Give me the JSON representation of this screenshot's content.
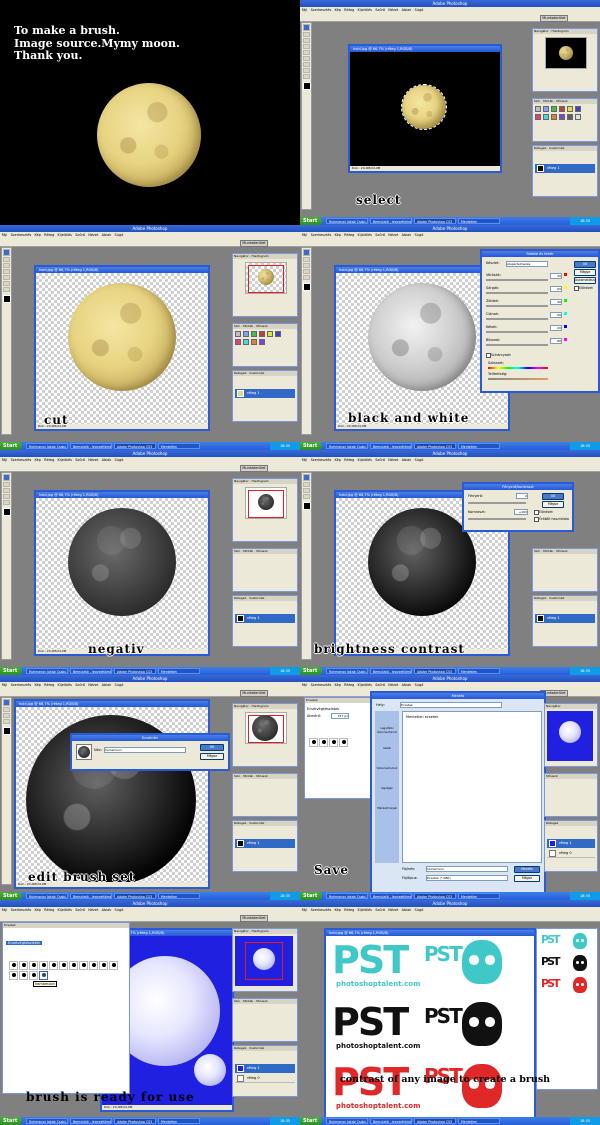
{
  "intro": {
    "line1": "To make a brush.",
    "line2": "Image source.Mymy moon.",
    "line3": "Thank you."
  },
  "app": {
    "title": "Adobe Photoshop",
    "menu": [
      "Fájl",
      "Szerkesztés",
      "Kép",
      "Réteg",
      "Kijelölés",
      "Szűrő",
      "Nézet",
      "Ablak",
      "Súgó"
    ],
    "workspace_button": "Munkaterület",
    "start_label": "Start",
    "tray_time": "18:35"
  },
  "document": {
    "title": "hold.jpg @ 66,7% (réteg 1,RGB/8)",
    "zoom": "66,67%",
    "status": "Dok.: 24,0M/24,0M"
  },
  "taskbar": {
    "items": [
      "Ruhmanov Jakab Csabi...",
      "Bemutató - Jegyzettömb",
      "Adobe Photoshop CS3",
      "Mentetlen"
    ]
  },
  "layers": {
    "row1": "réteg 1",
    "row2": "réteg 0"
  },
  "captions": {
    "select": "select",
    "cut": "cut",
    "bw": "black and white",
    "negativ": "negativ",
    "brightness": "brightness contrast",
    "edit": "edit brush set",
    "save": "Save",
    "ready": "brush is ready for use",
    "contrast": "contrast of any image to create a brush"
  },
  "bw_dialog": {
    "title": "Fekete és fehér",
    "preset_label": "Készlet:",
    "preset_value": "Alapértelmezés",
    "channels": [
      {
        "name": "Vörösök:",
        "value": "40",
        "color": "#ff0000"
      },
      {
        "name": "Sárgák:",
        "value": "60",
        "color": "#ffff00"
      },
      {
        "name": "Zöldek:",
        "value": "40",
        "color": "#00ff00"
      },
      {
        "name": "Ciánok:",
        "value": "60",
        "color": "#00ffff"
      },
      {
        "name": "Kékek:",
        "value": "20",
        "color": "#0000ff"
      },
      {
        "name": "Bíborok:",
        "value": "80",
        "color": "#ff00ff"
      }
    ],
    "tint_label": "Színárnyalat",
    "hue_label": "Színezet:",
    "sat_label": "Telítettség:",
    "ok": "OK",
    "cancel": "Mégse",
    "auto": "Automatikus",
    "preview": "Előnézet"
  },
  "bc_dialog": {
    "title": "Fényerő/kontraszt",
    "brightness_label": "Fényerő:",
    "brightness_value": "0",
    "contrast_label": "Kontraszt:",
    "contrast_value": "+100",
    "ok": "OK",
    "cancel": "Mégse",
    "preview": "Előnézet",
    "legacy": "Örökölt használata"
  },
  "brush_name_dialog": {
    "title": "Ecsetnév",
    "name_label": "Név:",
    "name_value": "hamamoon",
    "ok": "OK",
    "cancel": "Mégse"
  },
  "save_dialog": {
    "title": "Mentés",
    "location_label": "Hely:",
    "location_value": "Ecsetek",
    "file_label": "Fájlnév:",
    "file_value": "hamamoon",
    "type_label": "Fájltípus:",
    "type_value": "Ecsetek (*.ABR)",
    "save_btn": "Mentés",
    "cancel_btn": "Mégse",
    "places": [
      "Legutóbbi dokumentumok",
      "Asztal",
      "Dokumentumok",
      "Sajátgép",
      "Hálózati helyek"
    ],
    "folder_item": "Mentetlen ecsetek"
  },
  "brushes_panel": {
    "title": "Ecsetek",
    "presets_label": "Ecsetvégkészletek",
    "size_label": "Átmérő:",
    "size_value": "377 px",
    "tooltip": "hamamoon"
  },
  "pst": {
    "logo": "PST",
    "site": "photoshoptalent.com"
  },
  "colors": {
    "ps_blue": "#2a5bd7",
    "workspace_gray": "#808080",
    "cyan_brush": "#40c8c8",
    "red_brush": "#e02828",
    "blue_bg": "#2020e0"
  }
}
